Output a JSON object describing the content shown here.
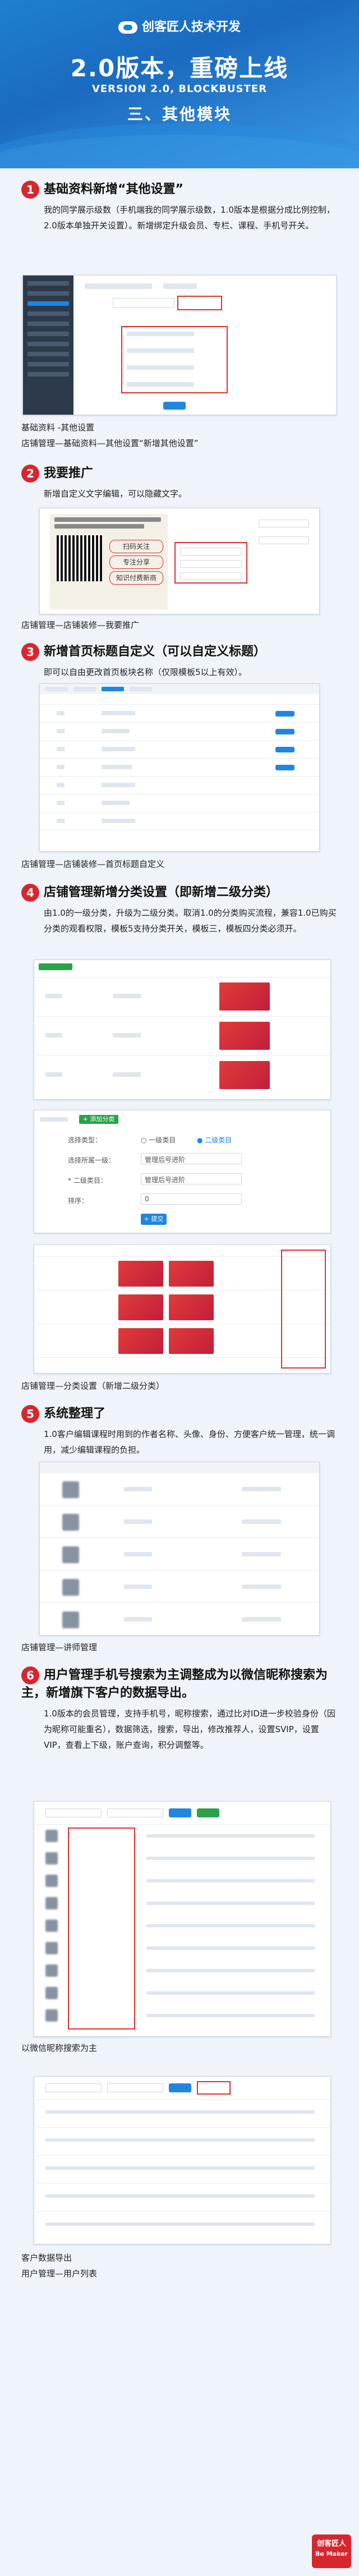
{
  "header": {
    "brand": "创客匠人技术开发",
    "title": "2.0版本，重磅上线",
    "subtitle": "VERSION 2.0, BLOCKBUSTER",
    "section": "三、其他模块"
  },
  "sections": [
    {
      "num": "1",
      "title": "基础资料新增“其他设置”",
      "desc": "我的同学展示级数（手机端我的同学展示级数，1.0版本是根据分成比例控制，2.0版本单独开关设置）。新增绑定升级会员、专栏、课程、手机号开关。",
      "captions": [
        "基础资料 -其他设置",
        "店铺管理—基础资料—其他设置“新增其他设置”"
      ]
    },
    {
      "num": "2",
      "title": "我要推广",
      "desc": "新增自定义文字编辑，可以隐藏文字。",
      "captions": [
        "店铺管理—店铺装修—我要推广"
      ],
      "poster_text": [
        "扫码关注",
        "专注分享",
        "知识付费新商"
      ]
    },
    {
      "num": "3",
      "title": "新增首页标题自定义（可以自定义标题）",
      "desc": "即可以自由更改首页板块名称（仅限模板5以上有效）。",
      "captions": [
        "店铺管理—店铺装修—首页标题自定义"
      ]
    },
    {
      "num": "4",
      "title": "店铺管理新增分类设置（即新增二级分类）",
      "desc": "由1.0的一级分类，升级为二级分类。取消1.0的分类购买流程，兼容1.0已购买分类的观看权限，模板5支持分类开关，模板三，模板四分类必须开。",
      "captions": [
        "店铺管理—分类设置（新增二级分类）"
      ],
      "form": {
        "type_label": "选择类型：",
        "opt1": "一级类目",
        "opt2": "二级类目",
        "parent_label": "选择所属一级：",
        "parent_value": "管理后号进阶",
        "name_label": "* 二级类目：",
        "name_value": "管理后号进阶",
        "sort_label": "排序：",
        "sort_value": "0",
        "submit": "+ 提交",
        "add": "+ 添加分类"
      }
    },
    {
      "num": "5",
      "title": "系统整理了",
      "desc": "1.0客户编辑课程时用到的作者名称、头像、身份、方便客户统一管理，统一调用，减少编辑课程的负担。",
      "captions": [
        "店铺管理—讲师管理"
      ]
    },
    {
      "num": "6",
      "title": "用户管理手机号搜索为主调整成为以微信昵称搜索为主，新增旗下客户的数据导出。",
      "desc": "1.0版本的会员管理，支持手机号，昵称搜索，通过比对ID进一步校验身份（因为昵称可能重名），数据筛选，搜索，导出，修改推荐人，设置SVIP，设置VIP，查看上下级，账户查询，积分调整等。",
      "captions": [
        "以微信昵称搜索为主",
        "客户数据导出",
        "用户管理—用户列表"
      ]
    }
  ],
  "footer": {
    "logo_line1": "创客匠人",
    "logo_line2": "Be Maker"
  }
}
